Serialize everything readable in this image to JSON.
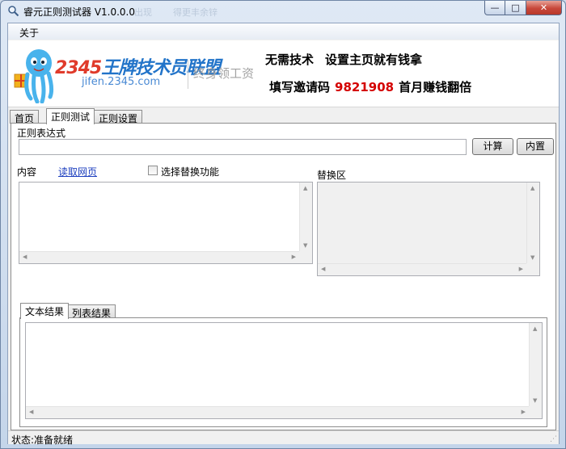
{
  "window": {
    "title": "睿元正则测试器 V1.0.0.0",
    "ghost_tabs": [
      "出现",
      "得更丰余锌"
    ],
    "caption": {
      "min_glyph": "—",
      "max_glyph": "□",
      "close_glyph": "✕"
    }
  },
  "menu": {
    "about_label": "关于"
  },
  "banner": {
    "logo_digits": "2345",
    "logo_text": "王牌技术员联盟",
    "logo_url": "jifen.2345.com",
    "slogan": "终身领工资",
    "ad_line1_a": "无需技术",
    "ad_line1_b": "设置主页就有钱拿",
    "ad_line2_a": "填写邀请码",
    "ad_code": "9821908",
    "ad_line2_b": "首月赚钱翻倍",
    "colors": {
      "logo_blue": "#2274c9",
      "logo_red": "#e03b2b",
      "code_red": "#d40000"
    }
  },
  "tabs": [
    {
      "label": "首页"
    },
    {
      "label": "正则测试"
    },
    {
      "label": "正则设置"
    }
  ],
  "panel": {
    "regex_label": "正则表达式",
    "regex_value": "",
    "calc_button": "计算",
    "builtin_button": "内置",
    "content_label": "内容",
    "read_page_link": "读取网页",
    "replace_checkbox_label": "选择替换功能",
    "replace_area_label": "替换区",
    "content_value": "",
    "replace_value": "",
    "result_tabs": [
      {
        "label": "文本结果"
      },
      {
        "label": "列表结果"
      }
    ],
    "result_value": ""
  },
  "status": {
    "text": "状态:准备就绪"
  }
}
